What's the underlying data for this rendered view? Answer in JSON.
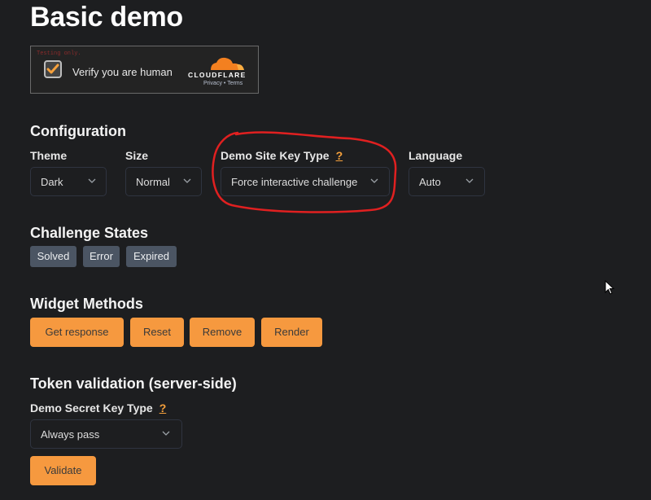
{
  "page": {
    "title": "Basic demo"
  },
  "widget": {
    "testing_label": "Testing only.",
    "checkbox_checked": true,
    "verify_text": "Verify you are human",
    "brand": "CLOUDFLARE",
    "privacy": "Privacy",
    "separator": "•",
    "terms": "Terms",
    "brand_color": "#f38020"
  },
  "configuration": {
    "heading": "Configuration",
    "theme": {
      "label": "Theme",
      "value": "Dark"
    },
    "size": {
      "label": "Size",
      "value": "Normal"
    },
    "site_key_type": {
      "label": "Demo Site Key Type",
      "help": "?",
      "value": "Force interactive challenge"
    },
    "language": {
      "label": "Language",
      "value": "Auto"
    }
  },
  "challenge_states": {
    "heading": "Challenge States",
    "items": [
      "Solved",
      "Error",
      "Expired"
    ]
  },
  "widget_methods": {
    "heading": "Widget Methods",
    "buttons": [
      "Get response",
      "Reset",
      "Remove",
      "Render"
    ]
  },
  "token_validation": {
    "heading": "Token validation (server-side)",
    "secret_key_type": {
      "label": "Demo Secret Key Type",
      "help": "?",
      "value": "Always pass"
    },
    "validate_label": "Validate"
  },
  "colors": {
    "accent": "#f6993f",
    "annotation": "#e02020",
    "badge": "#4b5563",
    "background": "#1d1e20"
  }
}
